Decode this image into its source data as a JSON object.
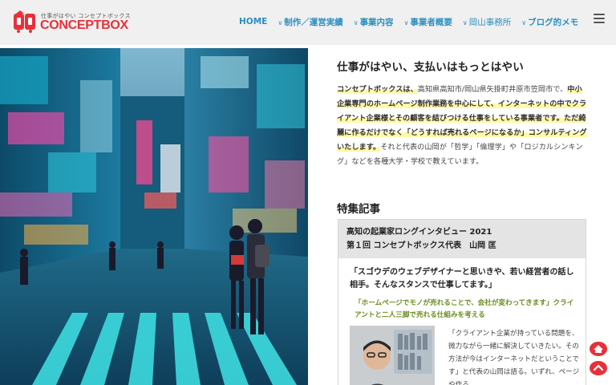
{
  "header": {
    "logo_tagline": "仕事がはやい コンセプトボックス",
    "logo_name": "CONCEPTBOX",
    "nav": [
      {
        "label": "HOME",
        "chevron": false,
        "bold": true
      },
      {
        "label": "制作／運営実績",
        "chevron": true,
        "bold": true
      },
      {
        "label": "事業内容",
        "chevron": true,
        "bold": true
      },
      {
        "label": "事業者概要",
        "chevron": true,
        "bold": true
      },
      {
        "label": "岡山事務所",
        "chevron": true,
        "bold": false
      },
      {
        "label": "ブログ的メモ",
        "chevron": true,
        "bold": true
      }
    ],
    "menu_icon": "hamburger-icon"
  },
  "intro": {
    "title": "仕事がはやい、支払いはもっとはやい",
    "p1": "コンセプトボックスは、",
    "p2": "高知県高知市/岡山県矢掛町井原市笠岡市で、",
    "p3": "中小企業専門のホームページ制作業務を中心にして、インターネットの中でクライアント企業様とその顧客を結びつける仕事をしている事業者です。ただ綺麗に作るだけでなく「どうすれば売れるページになるか」コンサルティングいたします。",
    "p4": "それと代表の山岡が「哲学」「倫理学」や「ロジカルシンキング」などを各種大学・学校で教えています。"
  },
  "feature": {
    "title": "特集記事",
    "card_head_line1": "高知の起業家ロングインタビュー 2021",
    "card_head_line2": "第１回 コンセプトボックス代表　山岡 匡",
    "quote": "「スゴウデのウェブデザイナーと思いきや、若い経営者の話し相手。そんなスタンスで仕事してます。」",
    "sub_quote": "「ホームページでモノが売れることで、会社が変わってきます」クライアントと二人三脚で売れる仕組みを考える",
    "body": "「クライアント企業が持っている問題を、微力ながら一緒に解決していきたい。その方法が今はインターネットだということです」と代表の山岡は語る。いずれ、ページや作る"
  },
  "floating": {
    "home_icon": "home-icon",
    "top_icon": "chevron-up-icon"
  },
  "colors": {
    "brand_red": "#e8303a",
    "nav_blue": "#2a8fbf",
    "highlight": "#fff9a8",
    "sub_green": "#6a8c1f"
  }
}
